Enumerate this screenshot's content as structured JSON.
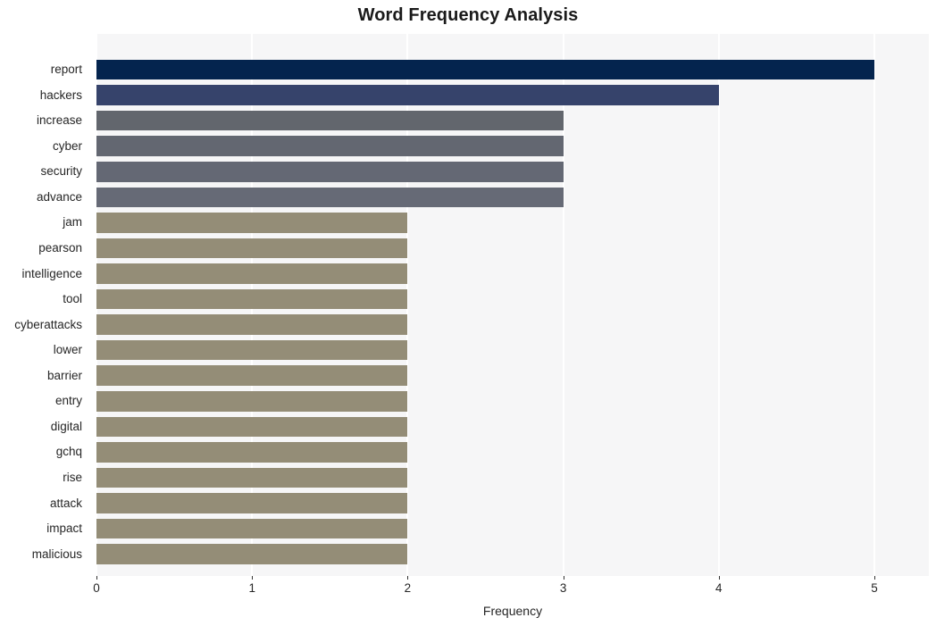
{
  "chart_data": {
    "type": "bar",
    "orientation": "horizontal",
    "title": "Word Frequency Analysis",
    "xlabel": "Frequency",
    "ylabel": "",
    "xlim": [
      0,
      5.35
    ],
    "xticks": [
      0,
      1,
      2,
      3,
      4,
      5
    ],
    "xtick_labels": [
      "0",
      "1",
      "2",
      "3",
      "4",
      "5"
    ],
    "grid": "vertical",
    "legend": null,
    "categories": [
      "report",
      "hackers",
      "increase",
      "cyber",
      "security",
      "advance",
      "jam",
      "pearson",
      "intelligence",
      "tool",
      "cyberattacks",
      "lower",
      "barrier",
      "entry",
      "digital",
      "gchq",
      "rise",
      "attack",
      "impact",
      "malicious"
    ],
    "values": [
      5,
      4,
      3,
      3,
      3,
      3,
      2,
      2,
      2,
      2,
      2,
      2,
      2,
      2,
      2,
      2,
      2,
      2,
      2,
      2
    ],
    "bar_colors": [
      "#04244e",
      "#36436b",
      "#62666d",
      "#636771",
      "#646874",
      "#666a76",
      "#948d77",
      "#948d77",
      "#948d77",
      "#948d77",
      "#948d77",
      "#948d77",
      "#948d77",
      "#948d77",
      "#948d77",
      "#948d77",
      "#948d77",
      "#948d77",
      "#948d77",
      "#948d77"
    ],
    "plot_background": "#f6f6f7",
    "gridline_color": "#ffffff",
    "figure_background": "#ffffff"
  }
}
